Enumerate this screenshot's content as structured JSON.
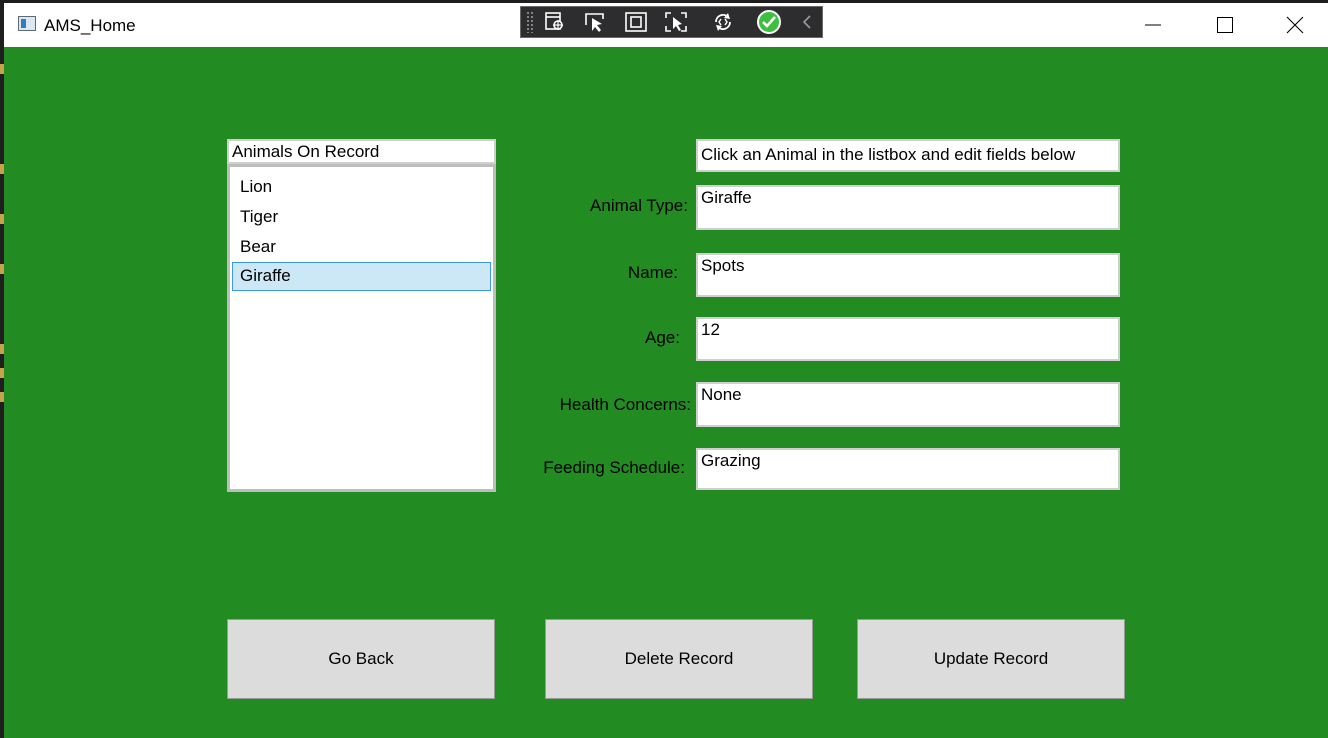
{
  "window": {
    "title": "AMS_Home",
    "icons": [
      "app-icon",
      "minimize-icon",
      "maximize-icon",
      "close-icon"
    ]
  },
  "debug_toolbar": {
    "icons": [
      "live-visual-tree-icon",
      "select-element-icon",
      "display-layout-adorners-icon",
      "track-focused-element-icon",
      "hot-reload-icon",
      "hot-reload-status-check-icon",
      "collapse-chevron-icon"
    ],
    "accent_check_color": "#3fbf3f"
  },
  "colors": {
    "background": "#228b22",
    "button_face": "#dcdcdc",
    "selection_fill": "#cce8f7",
    "selection_border": "#3c9ad8"
  },
  "list": {
    "header": "Animals On Record",
    "items": [
      "Lion",
      "Tiger",
      "Bear",
      "Giraffe"
    ],
    "selected": "Giraffe"
  },
  "form": {
    "instructions": "Click an Animal in the listbox and edit fields below",
    "fields": [
      {
        "label": "Animal Type:",
        "value": "Giraffe"
      },
      {
        "label": "Name:",
        "value": "Spots"
      },
      {
        "label": "Age:",
        "value": "12"
      },
      {
        "label": "Health Concerns:",
        "value": "None"
      },
      {
        "label": "Feeding Schedule:",
        "value": "Grazing"
      }
    ]
  },
  "buttons": {
    "go_back": "Go Back",
    "delete": "Delete Record",
    "update": "Update Record"
  }
}
